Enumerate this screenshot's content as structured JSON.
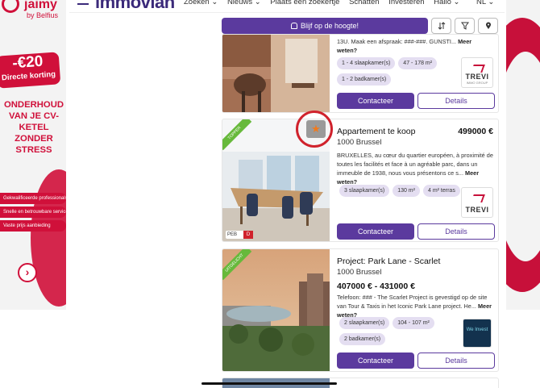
{
  "ads": {
    "left": {
      "brand": "jaimy",
      "brand_sub": "by Belfius",
      "promo_big": "-€20",
      "promo_small": "Directe korting",
      "headline": "ONDERHOUD VAN JE CV-KETEL ZONDER STRESS",
      "bullets": [
        "Gekwalificeerde professionals",
        "Snelle en betrouwbare service",
        "Vaste prijs aanbieding"
      ]
    }
  },
  "header": {
    "logo": "immovlan",
    "nav": [
      "Zoeken ⌄",
      "Nieuws ⌄",
      "Plaats een zoekertje",
      "Schatten",
      "Investeren",
      "Hallo ⌄"
    ],
    "lang": "NL ⌄"
  },
  "search": {
    "alert_label": "Blijf op de hoogte!",
    "sort_icon": "sort-icon",
    "filter_icon": "filter-icon",
    "map_icon": "map-pin-icon"
  },
  "listings": [
    {
      "desc": "13U. Maak een afspraak: ###-###. GUNSTI...",
      "more": "Meer weten?",
      "tags": [
        "1 - 4 slaapkamer(s)",
        "47 - 178 m²",
        "1 - 2 badkamer(s)"
      ],
      "agency": "TREVI",
      "agency_sub": "IMMO GROUP",
      "contact": "Contacteer",
      "details": "Details"
    },
    {
      "badge": "TOPPER",
      "title": "Appartement te koop",
      "price": "499000 €",
      "city": "1000 Brussel",
      "desc": "BRUXELLES, au cœur du quartier européen, à proximité de toutes les facilités et face à un agréable parc, dans un immeuble de 1938, nous vous présentons ce s...",
      "more": "Meer weten?",
      "tags": [
        "3 slaapkamer(s)",
        "130 m²",
        "4 m² terras"
      ],
      "agency": "TREVI",
      "peb": "PEB",
      "peb_rating": "D",
      "contact": "Contacteer",
      "details": "Details"
    },
    {
      "badge": "UITGELICHT",
      "title": "Project: Park Lane - Scarlet",
      "price": "407000 € - 431000 €",
      "city": "1000 Brussel",
      "desc": "Telefoon: ### - The Scarlet Project is gevestigd op de site van Tour & Taxis in het Iconic Park Lane project. He...",
      "more": "Meer weten?",
      "tags": [
        "2 slaapkamer(s)",
        "104 - 107 m²",
        "2 badkamer(s)"
      ],
      "agency": "We Invest",
      "contact": "Contacteer",
      "details": "Details"
    }
  ],
  "colors": {
    "primary": "#5b3a9e",
    "accent": "#c7103a",
    "tag_bg": "#e4def1",
    "badge_green": "#67b93b",
    "star": "#f07a1d"
  }
}
